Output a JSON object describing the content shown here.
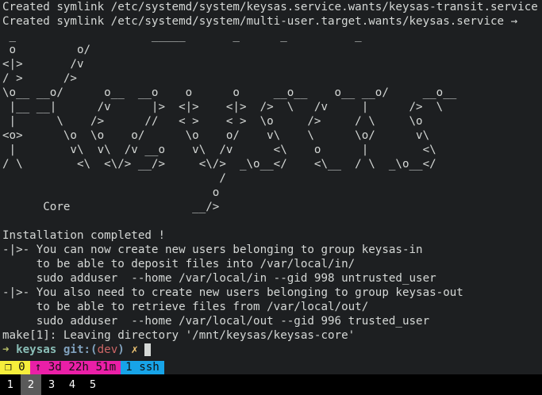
{
  "terminal": {
    "lines": [
      "Created symlink /etc/systemd/system/keysas.service.wants/keysas-transit.service",
      "Created symlink /etc/systemd/system/multi-user.target.wants/keysas.service →",
      " _                    _____       _      _          _",
      " o         o/",
      "<|>       /v",
      "/ >      />",
      "\\o__ __o/      o__  __o    o      o     __o__    o__ __o/     __o__",
      " |__ __|      /v      |>  <|>    <|>  />  \\   /v     |      />  \\",
      " |      \\    />      //   < >    < >  \\o     />     / \\     \\o",
      "<o>      \\o  \\o    o/      \\o    o/    v\\    \\      \\o/      v\\",
      " |        v\\  v\\  /v __o    v\\  /v      <\\    o      |        <\\",
      "/ \\        <\\  <\\/> __/>     <\\/>  _\\o__</    <\\__  / \\  _\\o__</",
      "                                /",
      "                               o",
      "      Core                  __/>",
      "",
      "Installation completed !",
      "-|>- You can now create new users belonging to group keysas-in",
      "     to be able to deposit files into /var/local/in/",
      "     sudo adduser  --home /var/local/in --gid 998 untrusted_user",
      "-|>- You also need to create new users belonging to group keysas-out",
      "     to be able to retrieve files from /var/local/out/",
      "     sudo adduser  --home /var/local/out --gid 996 trusted_user",
      "make[1]: Leaving directory '/mnt/keysas/keysas-core'"
    ],
    "prompt": {
      "arrow": "➜",
      "dir": "keysas",
      "git_prefix": "git:(",
      "branch": "dev",
      "git_suffix": ")",
      "dirty": "✗"
    }
  },
  "statusbar": {
    "jobs": "❒ 0",
    "uptime": "↑ 3d 22h 51m",
    "ssh": "1 ssh"
  },
  "workspaces": [
    "1",
    "2",
    "3",
    "4",
    "5"
  ],
  "active_workspace": "2",
  "colors": {
    "terminal_bg": "#1d1f21",
    "jobs_bg": "#f6ee3b",
    "uptime_bg": "#ea1fa7",
    "ssh_bg": "#17a4e8",
    "active_workspace_bg": "#5a5a5a"
  }
}
